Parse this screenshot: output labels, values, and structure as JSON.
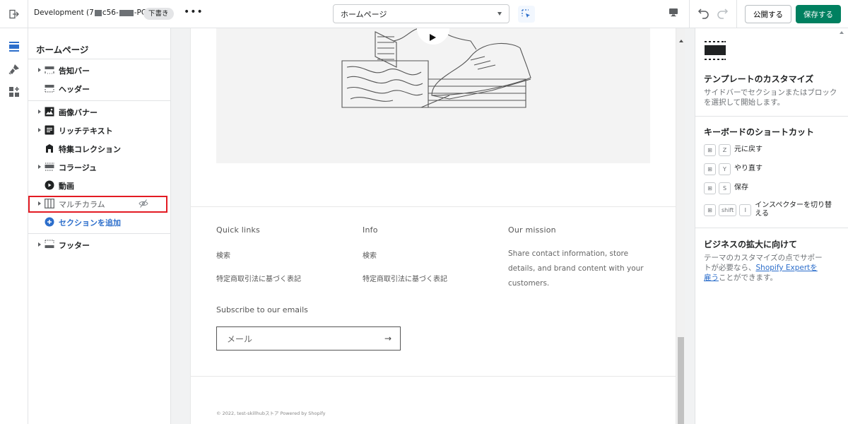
{
  "topbar": {
    "theme_name_prefix": "Development (7",
    "theme_name_mid": "c56-",
    "theme_name_suffix": "-PC)",
    "draft_badge": "下書き",
    "more": "•••",
    "page_select_value": "ホームページ",
    "publish_label": "公開する",
    "save_label": "保存する"
  },
  "sidebar": {
    "title": "ホームページ",
    "header_items": [
      {
        "label": "告知バー",
        "icon": "announcement-bar-icon",
        "expandable": true
      },
      {
        "label": "ヘッダー",
        "icon": "header-icon",
        "expandable": false
      }
    ],
    "template_items": [
      {
        "label": "画像バナー",
        "icon": "image-icon",
        "expandable": true
      },
      {
        "label": "リッチテキスト",
        "icon": "text-block-icon",
        "expandable": true
      },
      {
        "label": "特集コレクション",
        "icon": "collection-icon",
        "expandable": false
      },
      {
        "label": "コラージュ",
        "icon": "collage-icon",
        "expandable": true
      },
      {
        "label": "動画",
        "icon": "play-icon",
        "expandable": false
      },
      {
        "label": "マルチカラム",
        "icon": "columns-icon",
        "expandable": true,
        "hidden": true
      }
    ],
    "add_section_label": "セクションを追加",
    "footer_items": [
      {
        "label": "フッター",
        "icon": "footer-icon",
        "expandable": true
      }
    ]
  },
  "preview": {
    "footer": {
      "col1_heading": "Quick links",
      "col1_links": [
        "検索",
        "特定商取引法に基づく表記"
      ],
      "col2_heading": "Info",
      "col2_links": [
        "検索",
        "特定商取引法に基づく表記"
      ],
      "col3_heading": "Our mission",
      "col3_text": "Share contact information, store details, and brand content with your customers.",
      "subscribe_heading": "Subscribe to our emails",
      "email_placeholder": "メール",
      "copyright": "© 2022, test-skillhubストア Powered by Shopify"
    }
  },
  "right_panel": {
    "customize_title": "テンプレートのカスタマイズ",
    "customize_desc": "サイドバーでセクションまたはブロックを選択して開始します。",
    "shortcuts_title": "キーボードのショートカット",
    "shortcuts": [
      {
        "keys": [
          "⊞",
          "Z"
        ],
        "label": "元に戻す"
      },
      {
        "keys": [
          "⊞",
          "Y"
        ],
        "label": "やり直す"
      },
      {
        "keys": [
          "⊞",
          "S"
        ],
        "label": "保存"
      },
      {
        "keys": [
          "⊞",
          "shift",
          "I"
        ],
        "label": "インスペクターを切り替える"
      }
    ],
    "business_title": "ビジネスの拡大に向けて",
    "business_desc_before": "テーマのカスタマイズの点でサポートが必要なら、",
    "business_link": "Shopify Expertを雇う",
    "business_desc_after": "ことができます。"
  },
  "colors": {
    "accent_green": "#008060",
    "link_blue": "#2c6ecb",
    "highlight_red": "#e31b23"
  }
}
